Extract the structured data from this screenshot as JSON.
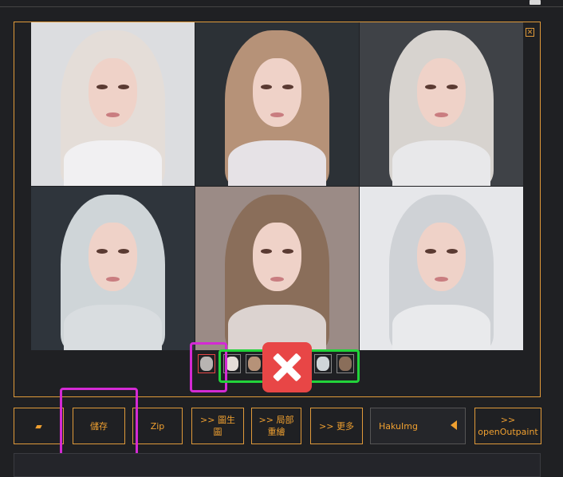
{
  "gallery": {
    "close_icon": "close-icon",
    "images": [
      {
        "bg": "#dcdde0",
        "hair": "#e4ddd8",
        "body": "#f1f0f2"
      },
      {
        "bg": "#2c3136",
        "hair": "#b69278",
        "body": "#e6e2e6"
      },
      {
        "bg": "#3f4247",
        "hair": "#d7d3cf",
        "body": "#e8e8ea"
      },
      {
        "bg": "#2f353c",
        "hair": "#cfd5d8",
        "body": "#d9dde0"
      },
      {
        "bg": "#9b8b86",
        "hair": "#8a6e5a",
        "body": "#dcd3d0"
      },
      {
        "bg": "#e6e7ea",
        "hair": "#cfd2d6",
        "body": "#e9eaec"
      }
    ],
    "thumb_count": 6
  },
  "toolbar": {
    "folder_icon": "folder-icon",
    "save_label": "儲存",
    "zip_label": "Zip",
    "img2img_label_1": ">> 圖生",
    "img2img_label_2": "圖",
    "inpaint_label_1": ">> 局部",
    "inpaint_label_2": "重繪",
    "more_label": ">> 更多",
    "hakuimg_label": "HakuImg",
    "openoutpaint_label_1": ">>",
    "openoutpaint_label_2": "openOutpaint"
  },
  "annotations": {
    "magenta": "#d42ad4",
    "green": "#22d33a",
    "red": "#e84646"
  }
}
